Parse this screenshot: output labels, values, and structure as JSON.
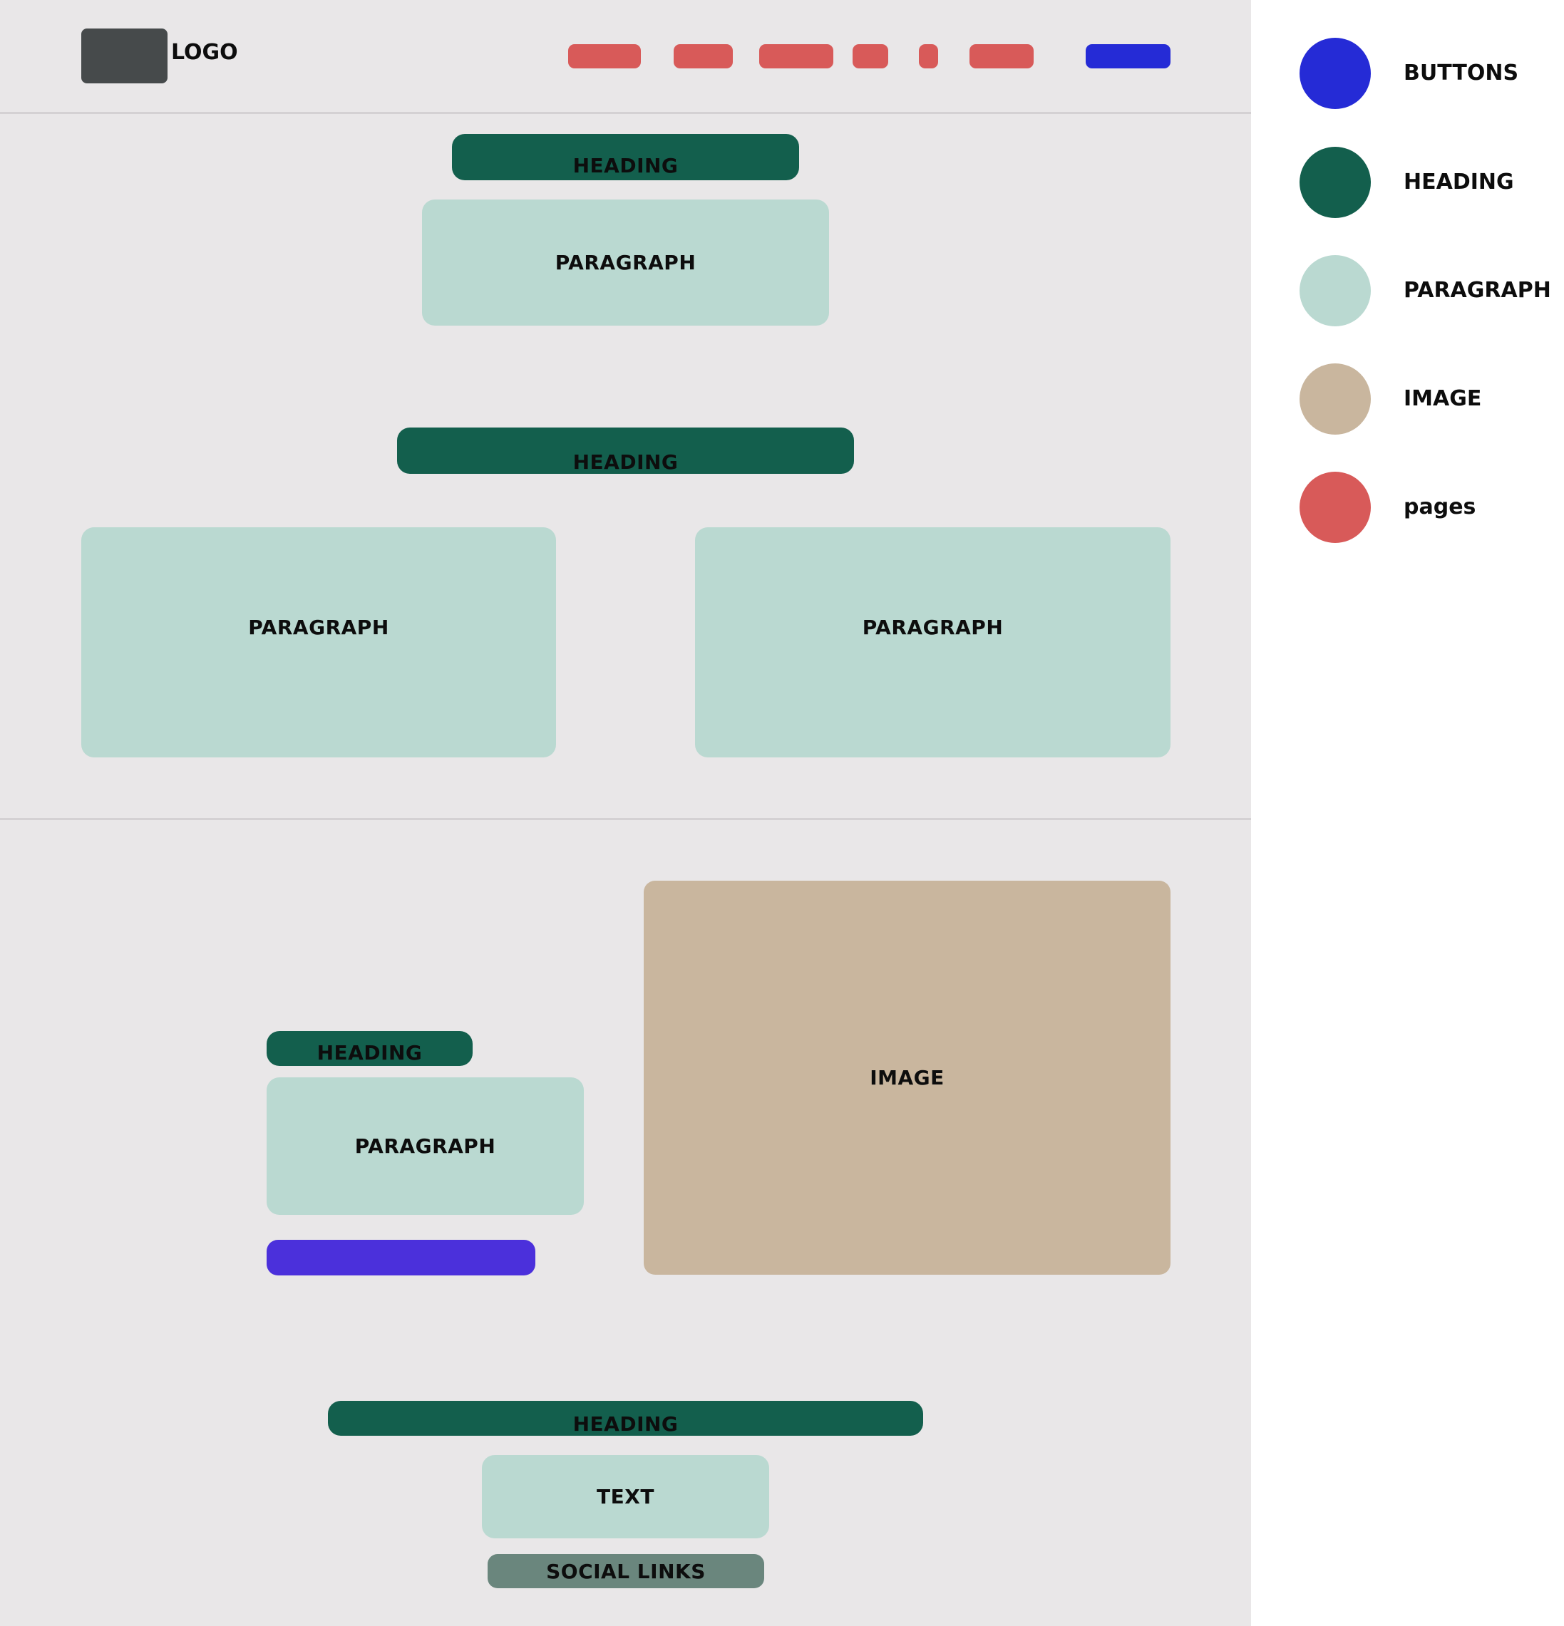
{
  "header": {
    "logo_label": "LOGO"
  },
  "colors": {
    "canvas_bg": "#e9e7e8",
    "buttons": "#252bd6",
    "cta_button": "#4b30db",
    "heading": "#135f4d",
    "paragraph": "#bad9d1",
    "image": "#c9b69e",
    "pages": "#d85a59",
    "logo": "#464a4b",
    "social_links": "#6a867d"
  },
  "section1": {
    "heading": "HEADING",
    "paragraph": "PARAGRAPH"
  },
  "section2": {
    "heading": "HEADING",
    "paragraph_left": "PARAGRAPH",
    "paragraph_right": "PARAGRAPH"
  },
  "section3": {
    "heading": "HEADING",
    "paragraph": "PARAGRAPH",
    "image": "IMAGE"
  },
  "footer": {
    "heading": "HEADING",
    "text": "TEXT",
    "social_links": "SOCIAL LINKS"
  },
  "legend": [
    {
      "label": "BUTTONS",
      "color": "#252bd6"
    },
    {
      "label": "HEADING",
      "color": "#135f4d"
    },
    {
      "label": "PARAGRAPH",
      "color": "#bad9d1"
    },
    {
      "label": "IMAGE",
      "color": "#c9b69e"
    },
    {
      "label": "pages",
      "color": "#d85a59"
    }
  ]
}
